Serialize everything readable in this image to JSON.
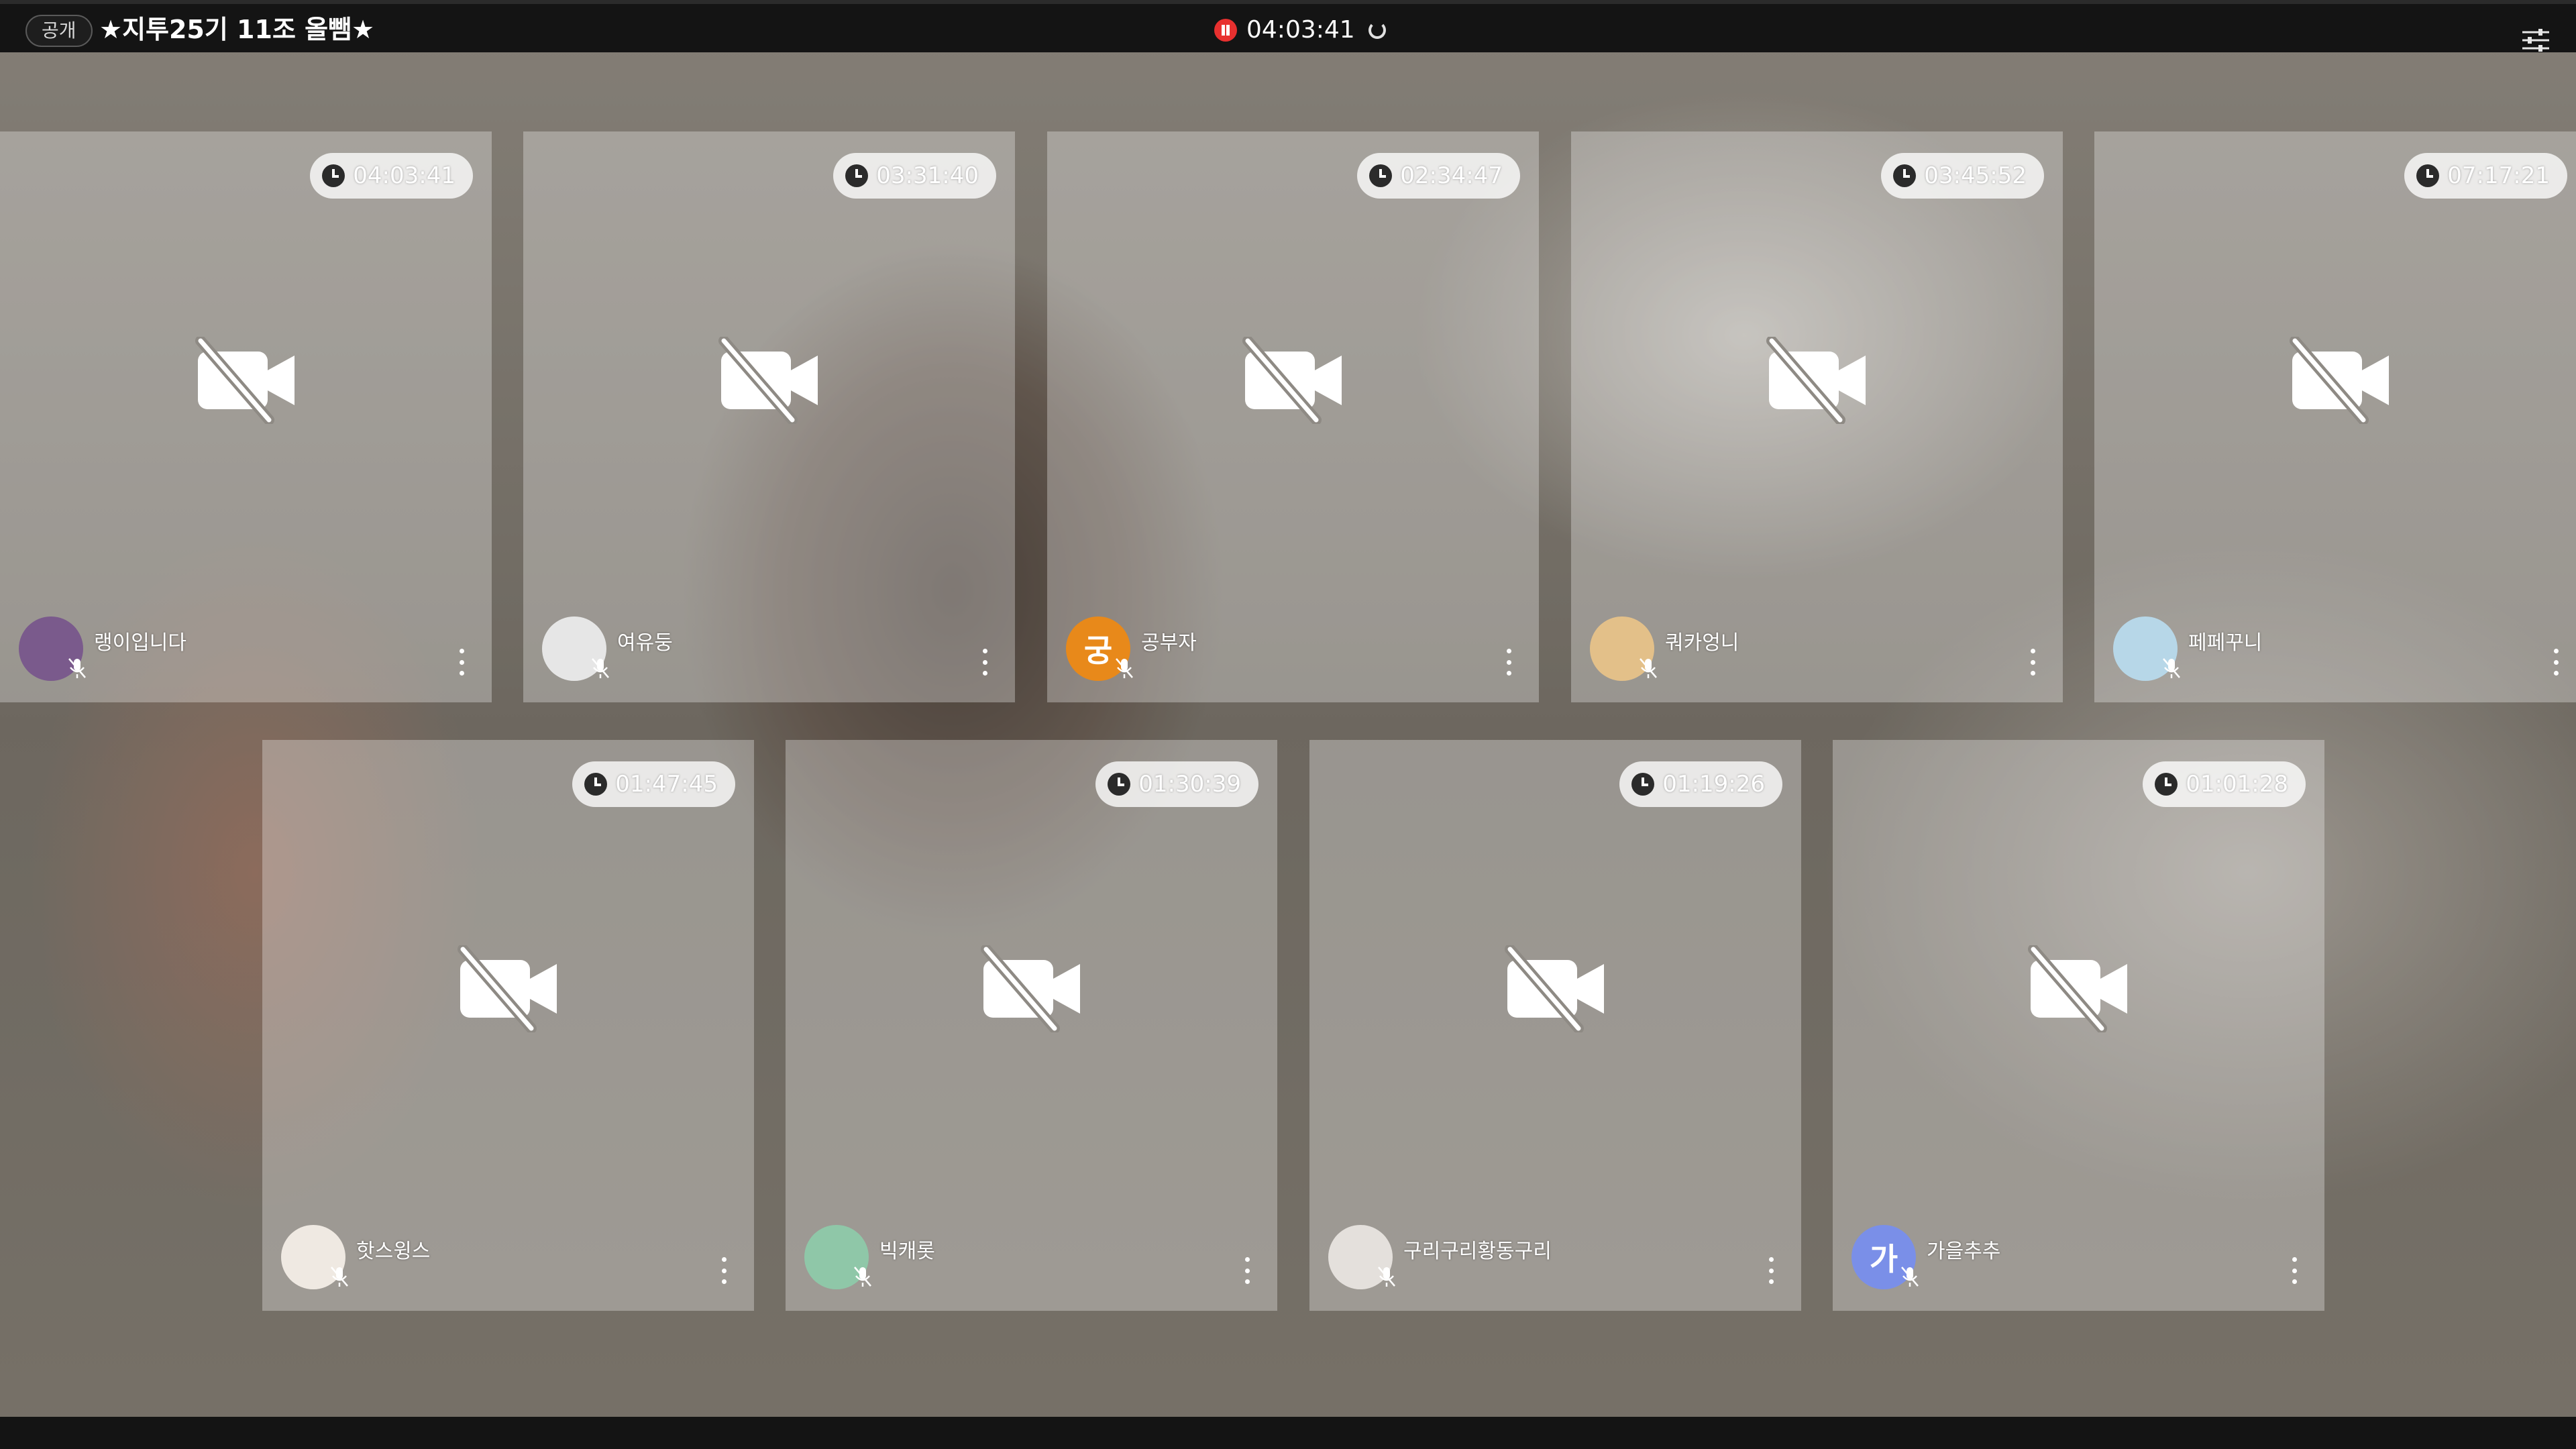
{
  "header": {
    "public_badge": "공개",
    "room_title": "★지투25기 11조 올뺌★",
    "elapsed_time": "04:03:41"
  },
  "colors": {
    "record": "#e8302f",
    "topbar": "#141414"
  },
  "participants": [
    {
      "name": "랭이입니다",
      "timer": "04:03:41",
      "avatar_color": "#7a5a8c",
      "avatar_text": ""
    },
    {
      "name": "여유둥",
      "timer": "03:31:40",
      "avatar_color": "#e6e6e6",
      "avatar_text": ""
    },
    {
      "name": "공부자",
      "timer": "02:34:47",
      "avatar_color": "#e8891a",
      "avatar_text": "궁"
    },
    {
      "name": "쿼카엉니",
      "timer": "03:45:52",
      "avatar_color": "#e3c089",
      "avatar_text": ""
    },
    {
      "name": "페페꾸니",
      "timer": "07:17:21",
      "avatar_color": "#b7d7e8",
      "avatar_text": ""
    },
    {
      "name": "핫스윙스",
      "timer": "01:47:45",
      "avatar_color": "#efe9e2",
      "avatar_text": ""
    },
    {
      "name": "빅캐롯",
      "timer": "01:30:39",
      "avatar_color": "#8fc7a8",
      "avatar_text": ""
    },
    {
      "name": "구리구리황동구리",
      "timer": "01:19:26",
      "avatar_color": "#e4e0dc",
      "avatar_text": ""
    },
    {
      "name": "가을추추",
      "timer": "01:01:28",
      "avatar_color": "#7a8fe8",
      "avatar_text": "가"
    }
  ]
}
